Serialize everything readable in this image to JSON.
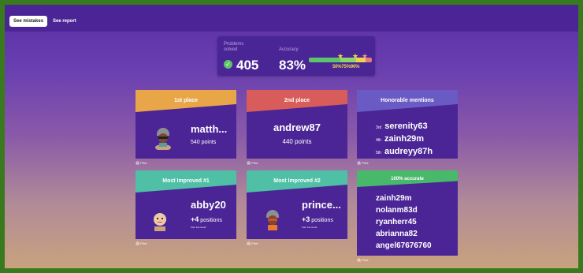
{
  "tabs": [
    {
      "label": "See mistakes",
      "active": true
    },
    {
      "label": "See report",
      "active": false
    }
  ],
  "stats": {
    "problems_label": "Problems\nsolved",
    "problems_value": "405",
    "accuracy_label": "Accuracy",
    "accuracy_value": "83%",
    "accuracy_fraction": 0.83,
    "thresholds": "50%75%90%"
  },
  "cards": {
    "first": {
      "heading": "1st place",
      "name": "matth...",
      "points": "540 points",
      "print": "Print",
      "color": "#e9a649"
    },
    "second": {
      "heading": "2nd place",
      "name": "andrew87",
      "points": "440 points",
      "print": "Print",
      "color": "#d85c5a"
    },
    "honorable": {
      "heading": "Honorable mentions",
      "print": "Print",
      "color": "#6a5bc4",
      "rows": [
        {
          "pos": "3rd",
          "name": "serenity63"
        },
        {
          "pos": "4th",
          "name": "zainh29m"
        },
        {
          "pos": "5th",
          "name": "audreyy87h"
        }
      ]
    },
    "improved1": {
      "heading": "Most Improved #1",
      "name": "abby20",
      "positions": "+4 positions",
      "count": "+4",
      "word": "positions",
      "from": "from 1st round",
      "print": "Print",
      "color": "#4fbfa6"
    },
    "improved2": {
      "heading": "Most Improved #2",
      "name": "prince...",
      "positions": "+3 positions",
      "count": "+3",
      "word": "positions",
      "from": "from 1st round",
      "print": "Print",
      "color": "#4fbfa6"
    },
    "accurate": {
      "heading": "100% accurate",
      "print": "Print",
      "color": "#48b86a",
      "names": [
        "zainh29m",
        "nolanm83d",
        "ryanherr45",
        "abrianna82",
        "angel67676760"
      ]
    }
  }
}
